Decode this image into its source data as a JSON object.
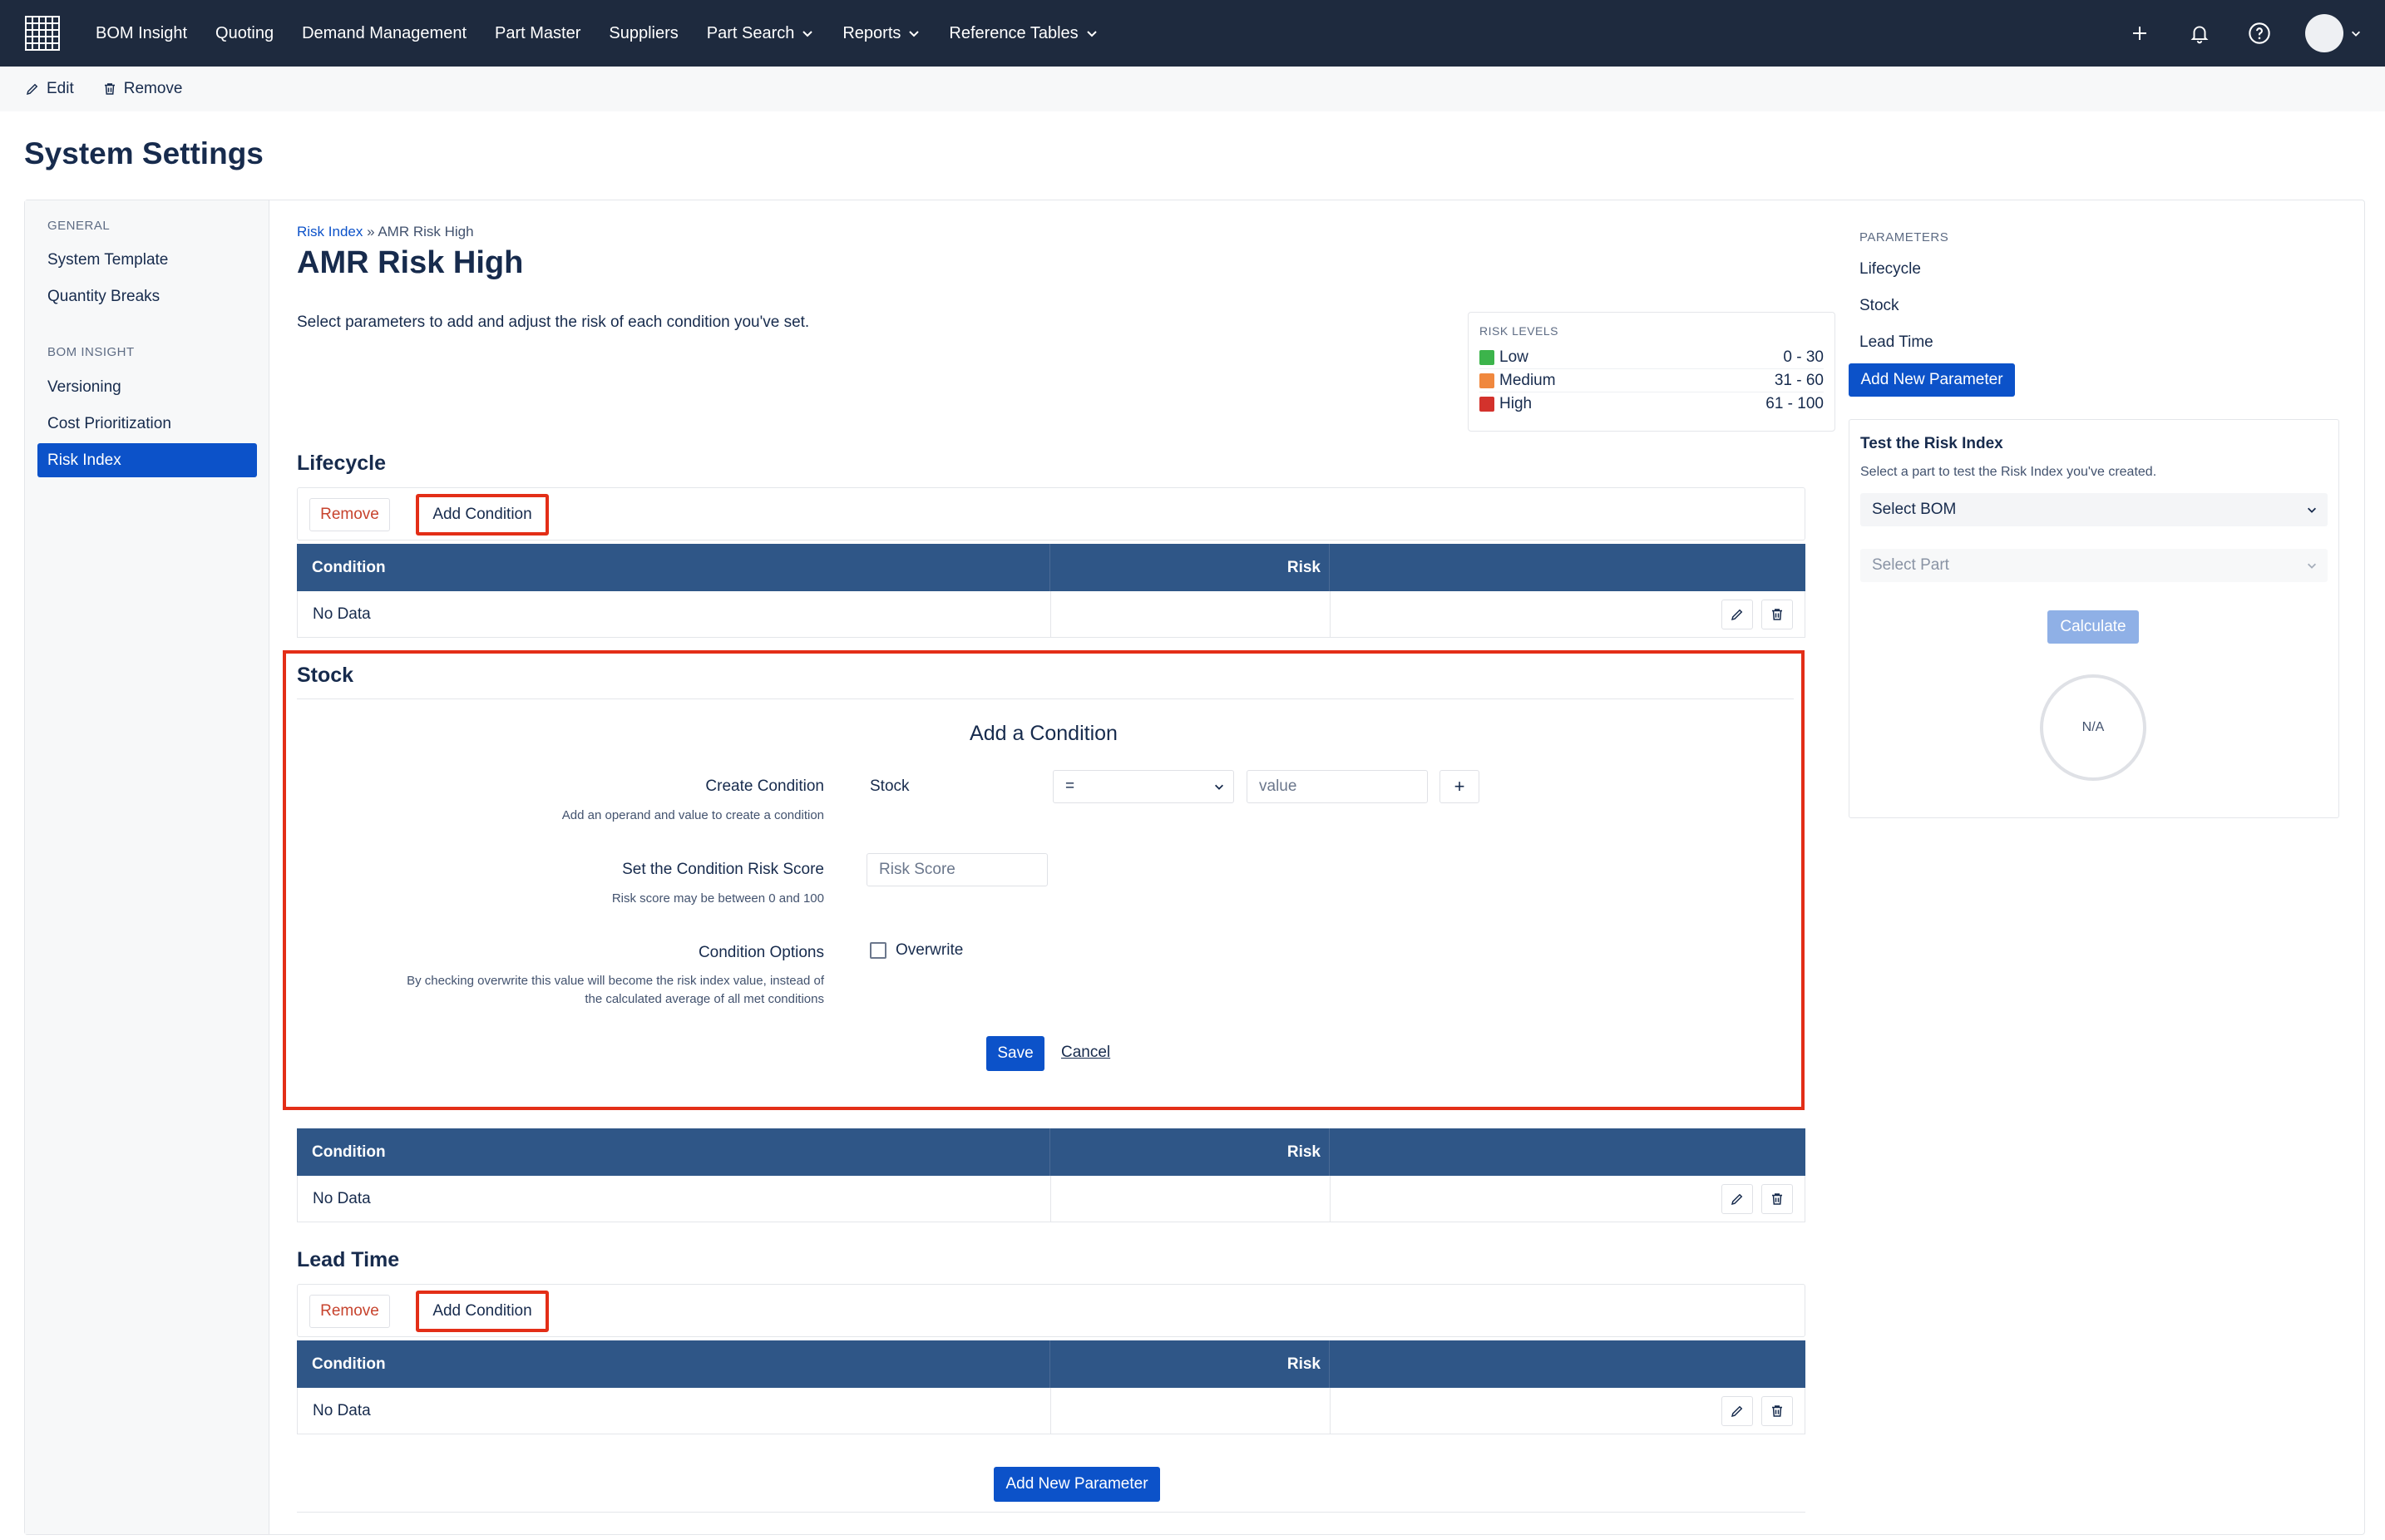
{
  "nav": {
    "items": [
      {
        "label": "BOM Insight"
      },
      {
        "label": "Quoting"
      },
      {
        "label": "Demand Management"
      },
      {
        "label": "Part Master"
      },
      {
        "label": "Suppliers"
      },
      {
        "label": "Part Search"
      },
      {
        "label": "Reports"
      },
      {
        "label": "Reference Tables"
      }
    ],
    "icons": [
      "plus-icon",
      "bell-icon",
      "help-icon",
      "avatar"
    ]
  },
  "actions": {
    "edit_label": "Edit",
    "remove_label": "Remove"
  },
  "page": {
    "title": "System Settings"
  },
  "sidebar": {
    "general_heading": "GENERAL",
    "general_items": [
      {
        "label": "System Template"
      },
      {
        "label": "Quantity Breaks"
      }
    ],
    "bom_heading": "BOM INSIGHT",
    "bom_items": [
      {
        "label": "Versioning"
      },
      {
        "label": "Cost Prioritization"
      },
      {
        "label": "Risk Index"
      }
    ],
    "active": "Risk Index"
  },
  "content": {
    "breadcrumb_parent": "Risk Index",
    "breadcrumb_sep": " » ",
    "breadcrumb_current": "AMR Risk High",
    "title": "AMR Risk High",
    "description": "Select parameters to add and adjust the risk of each condition you've set."
  },
  "risk_levels": {
    "heading": "RISK LEVELS",
    "levels": [
      {
        "label": "Low",
        "range": "0 - 30",
        "color": "#3cb44b"
      },
      {
        "label": "Medium",
        "range": "31 - 60",
        "color": "#f0883e"
      },
      {
        "label": "High",
        "range": "61 - 100",
        "color": "#d3322c"
      }
    ]
  },
  "sections": {
    "lifecycle": {
      "title": "Lifecycle",
      "remove_label": "Remove",
      "add_label": "Add Condition"
    },
    "stock": {
      "title": "Stock"
    },
    "lead_time": {
      "title": "Lead Time",
      "remove_label": "Remove",
      "add_label": "Add Condition"
    }
  },
  "table": {
    "col_condition": "Condition",
    "col_risk": "Risk",
    "empty": "No Data"
  },
  "form": {
    "title": "Add a Condition",
    "create_label": "Create Condition",
    "create_help": "Add an operand and value to create a condition",
    "parameter": "Stock",
    "operator": "=",
    "value_placeholder": "value",
    "plus": "+",
    "score_label": "Set the Condition Risk Score",
    "score_help": "Risk score may be between 0 and 100",
    "score_placeholder": "Risk Score",
    "options_label": "Condition Options",
    "options_help_1": "By checking overwrite this value will become the risk index value, instead of",
    "options_help_2": "the calculated average of all met conditions",
    "overwrite_label": "Overwrite",
    "save_label": "Save",
    "cancel_label": "Cancel"
  },
  "add_parameter_label": "Add New Parameter",
  "right_panel": {
    "heading": "PARAMETERS",
    "params": [
      {
        "label": "Lifecycle"
      },
      {
        "label": "Stock"
      },
      {
        "label": "Lead Time"
      }
    ],
    "add_label": "Add New Parameter",
    "test_title": "Test the Risk Index",
    "test_desc": "Select a part to test the Risk Index you've created.",
    "select_bom": "Select BOM",
    "select_part": "Select Part",
    "calc_label": "Calculate",
    "result": "N/A"
  }
}
